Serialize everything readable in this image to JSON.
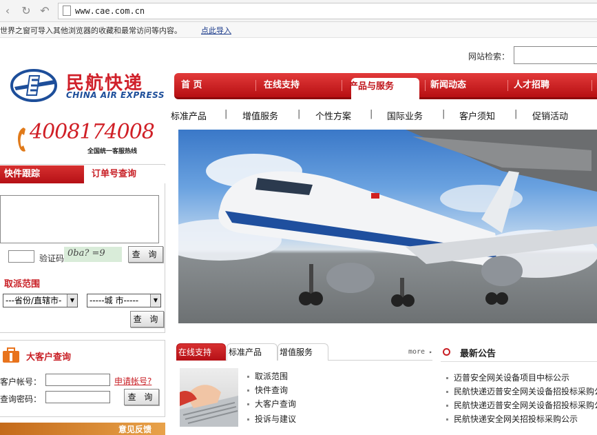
{
  "browser": {
    "url": "www.cae.com.cn",
    "infobar_message": "世界之窗可导入其他浏览器的收藏和最常访问等内容。",
    "infobar_link": "点此导入"
  },
  "header": {
    "search_label": "网站检索：",
    "logo_cn": "民航快递",
    "logo_en": "CHINA AIR EXPRESS"
  },
  "nav": {
    "items": [
      "首 页",
      "在线支持",
      "产品与服务",
      "新闻动态",
      "人才招聘"
    ],
    "active_index": 2
  },
  "subnav": {
    "items": [
      "标准产品",
      "增值服务",
      "个性方案",
      "国际业务",
      "客户须知",
      "促销活动"
    ],
    "separator": "|"
  },
  "hotline": {
    "number": "4008174008",
    "subtitle": "全国统一客服热线"
  },
  "tracking": {
    "tab_active": "快件跟踪",
    "tab_inactive": "订单号查询",
    "captcha_label": "验证码",
    "captcha_text": "0ba? =9",
    "query_label": "查 询"
  },
  "range": {
    "title": "取派范围",
    "province_placeholder": "---省份/直辖市-",
    "city_placeholder": "-----城 市-----",
    "query_label": "查 询"
  },
  "vip": {
    "title": "大客户查询",
    "account_label": "客户帐号：",
    "apply_link": "申请帐号?",
    "password_label": "查询密码：",
    "query_label": "查 询"
  },
  "feedback": {
    "label": "意见反馈"
  },
  "content_tabs": {
    "tabs": [
      "在线支持",
      "标准产品",
      "增值服务"
    ],
    "more": "more",
    "links": [
      "取派范围",
      "快件查询",
      "大客户查询",
      "投诉与建议"
    ]
  },
  "notices": {
    "title": "最新公告",
    "items": [
      "迈普安全网关设备项目中标公示",
      "民航快递迈普安全网关设备招投标采购公示",
      "民航快递迈普安全网关设备招投标采购公示",
      "民航快递安全网关招投标采购公示"
    ]
  },
  "colors": {
    "brand_red": "#c81e24",
    "brand_blue": "#1d4e9a"
  }
}
